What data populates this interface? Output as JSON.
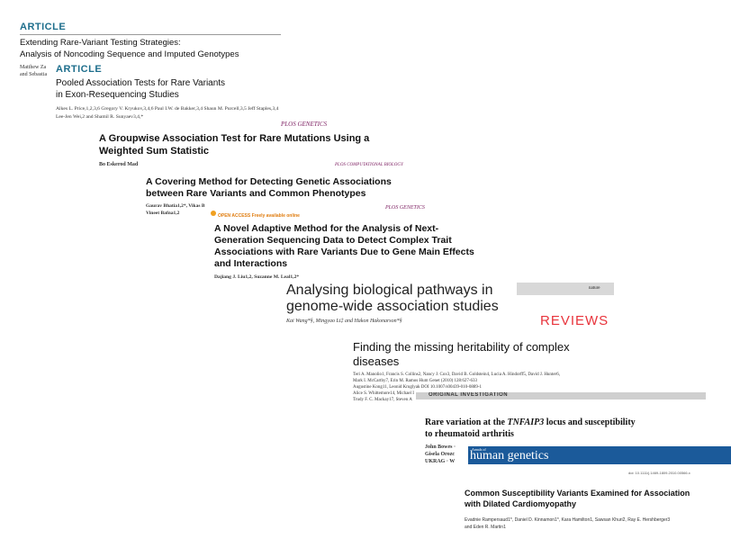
{
  "card1": {
    "tag": "ARTICLE",
    "title_line1": "Extending Rare-Variant Testing Strategies:",
    "title_line2": "Analysis of Noncoding Sequence and Imputed Genotypes",
    "authors_line1": "Matthew Za",
    "authors_line2": "and Sebastia"
  },
  "card2": {
    "tag": "ARTICLE",
    "title_line1": "Pooled Association Tests for Rare Variants",
    "title_line2": "in Exon-Resequencing Studies",
    "authors_line1": "Alkes L. Price,1,2,3,6 Gregory V. Kryukov,3,4,6 Paul I.W. de Bakker,3,4 Shaun M. Purcell,3,5 Jeff Staples,3,4",
    "authors_line2": "Lee-Jen Wei,2 and Shamil R. Sunyaev3,4,*"
  },
  "card3": {
    "journal": "PLOS GENETICS",
    "title_line1": "A Groupwise Association Test for Rare Mutations Using a",
    "title_line2": "Weighted Sum Statistic",
    "authors": "Bo Eskerod Mad",
    "journal2": "PLOS COMPUTATIONAL BIOLOGY"
  },
  "card4": {
    "title_line1": "A Covering Method for Detecting Genetic Associations",
    "title_line2": "between Rare Variants and Common Phenotypes",
    "authors_line1": "Gaurav Bhatia1,2*, Vikas B",
    "authors_line2": "Vineet Bafna1,2",
    "oa": "OPEN ACCESS Freely available online",
    "journal": "PLOS GENETICS"
  },
  "card5": {
    "title_line1": "A Novel Adaptive Method for the Analysis of Next-",
    "title_line2": "Generation Sequencing Data to Detect Complex Trait",
    "title_line3": "Associations with Rare Variants Due to Gene Main Effects",
    "title_line4": "and Interactions",
    "authors": "Dajiang J. Liu1,2, Suzanne M. Leal1,2*"
  },
  "card6": {
    "journal": "nature",
    "title_line1": "Analysing biological pathways in",
    "title_line2": "genome-wide association studies",
    "authors": "Kai Wang*§, Mingyao Li‡ and Hakon Hakonarson*§",
    "section": "REVIEWS"
  },
  "card7": {
    "title_line1": "Finding the missing heritability of complex",
    "title_line2": "diseases",
    "authors": [
      "Teri A. Manolio1, Francis S. Collins2, Nancy J. Cox3, David B. Goldstein4, Lucia A. Hindorff5, David J. Hunter6,",
      "Mark I. McCarthy7, Erin M. Ramos Hum Genet (2010) 128:627-633",
      "Augustine Kong11, Leonid Kruglyak DOI 10.1007/s00439-010-0889-1",
      "Alice S. Whittemore14, Michael I",
      "Trudy F. C. Mackay17, Steven A"
    ]
  },
  "card8": {
    "section": "ORIGINAL INVESTIGATION",
    "title_prefix": "Rare variation at the ",
    "title_gene": "TNFAIP3",
    "title_suffix": " locus and susceptibility",
    "title_line2": "to rheumatoid arthritis",
    "authors": [
      "John Bowes ·",
      "Gisela Orozc",
      "UKRAG · W"
    ]
  },
  "card9": {
    "banner_small": "Annals of",
    "banner_big": "human genetics",
    "doi": "doi: 10.1111/j.1469-1809.2010.00566.x",
    "title_line1": "Common Susceptibility Variants Examined for Association",
    "title_line2": "with Dilated Cardiomyopathy",
    "authors_line1": "Evadnie Rampersaud1*, Daniel D. Kinnamon1*, Kara Hamilton1, Sawsan Khuri2, Ray E. Hershberger3",
    "authors_line2": "and Eden R. Martin1"
  },
  "colors": {
    "article_tag": "#1e6e8c",
    "plos": "#7a1a5e",
    "open_access": "#e07d10",
    "reviews": "#e8343c",
    "annals_banner": "#1b5a9a"
  }
}
